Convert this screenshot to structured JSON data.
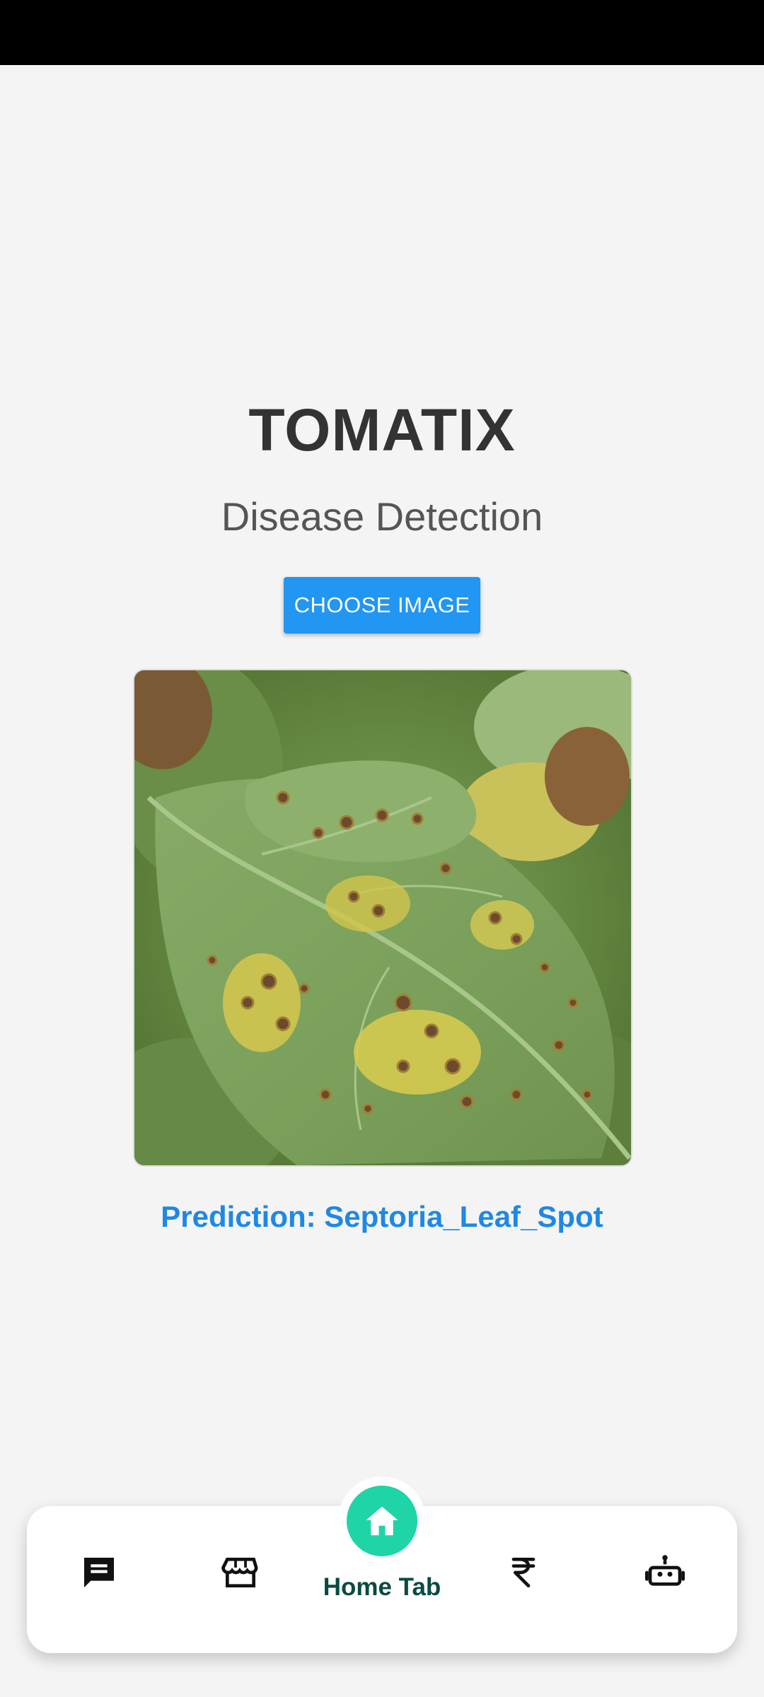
{
  "app": {
    "title": "TOMATIX",
    "subtitle": "Disease Detection"
  },
  "actions": {
    "choose_image_label": "CHOOSE IMAGE"
  },
  "result": {
    "prediction_text": "Prediction: Septoria_Leaf_Spot"
  },
  "bottom_nav": {
    "items": [
      {
        "icon": "chat-icon",
        "label": ""
      },
      {
        "icon": "store-icon",
        "label": ""
      },
      {
        "icon": "home-icon",
        "label": "Home Tab",
        "active": true
      },
      {
        "icon": "rupee-icon",
        "label": ""
      },
      {
        "icon": "robot-icon",
        "label": ""
      }
    ]
  },
  "colors": {
    "accent_button": "#2196f3",
    "prediction_text": "#1e88e5",
    "home_active": "#1fd4a6",
    "home_label": "#0b4a44"
  }
}
